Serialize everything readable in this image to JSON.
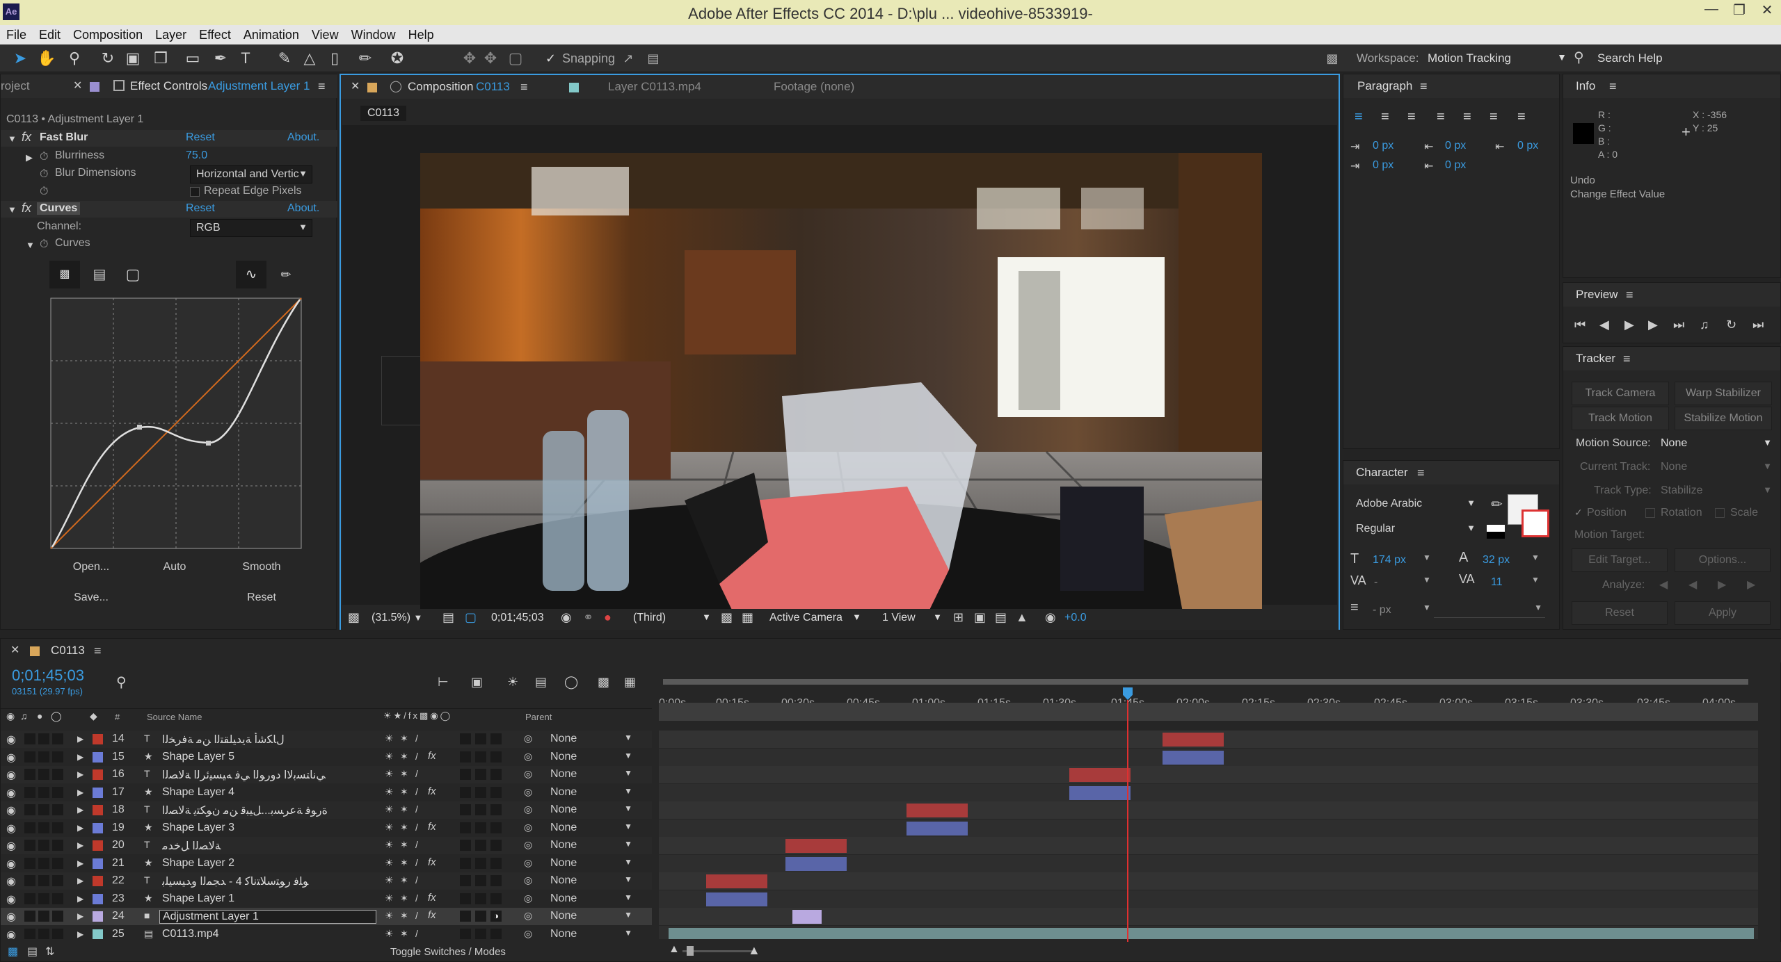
{
  "window": {
    "title": "Adobe After Effects CC 2014 - D:\\plu ... videohive-8533919-",
    "app_icon": "Ae",
    "controls": [
      "minimize-icon",
      "restore-icon",
      "close-icon"
    ]
  },
  "menu": [
    "File",
    "Edit",
    "Composition",
    "Layer",
    "Effect",
    "Animation",
    "View",
    "Window",
    "Help"
  ],
  "toolbar": {
    "snapping_label": "Snapping",
    "workspace_label": "Workspace:",
    "workspace_value": "Motion Tracking",
    "search_help": "Search Help"
  },
  "effect_controls": {
    "tab_project": "roject",
    "tab_label": "Effect Controls",
    "tab_layer": "Adjustment Layer 1",
    "breadcrumb": "C0113 • Adjustment Layer 1",
    "fast_blur": {
      "name": "Fast Blur",
      "reset": "Reset",
      "about": "About.",
      "blurriness_label": "Blurriness",
      "blurriness_value": "75.0",
      "blur_dimensions_label": "Blur Dimensions",
      "blur_dimensions_value": "Horizontal and Vertic",
      "repeat_edge": "Repeat Edge Pixels"
    },
    "curves": {
      "name": "Curves",
      "reset": "Reset",
      "about": "About.",
      "channel_label": "Channel:",
      "channel_value": "RGB",
      "curves_label": "Curves",
      "open": "Open...",
      "auto": "Auto",
      "smooth": "Smooth",
      "save": "Save...",
      "reset_btn": "Reset"
    }
  },
  "composition": {
    "tab_label": "Composition",
    "tab_name": "C0113",
    "layer_tab": "Layer  C0113.mp4",
    "footage_tab": "Footage  (none)",
    "comp_button": "C0113",
    "zoom": "(31.5%)",
    "timecode": "0;01;45;03",
    "resolution": "(Third)",
    "camera": "Active Camera",
    "views": "1 View",
    "exposure": "+0.0"
  },
  "paragraph": {
    "tab": "Paragraph",
    "indent_left": "0 px",
    "indent_first": "0 px",
    "space_before": "0 px",
    "indent_right": "0 px",
    "space_after": "0 px"
  },
  "info": {
    "tab": "Info",
    "r": "R :",
    "g": "G :",
    "b": "B :",
    "a": "A : 0",
    "x": "X : -356",
    "y": "Y : 25",
    "undo": "Undo",
    "undo_action": "Change Effect Value"
  },
  "preview": {
    "tab": "Preview"
  },
  "tracker": {
    "tab": "Tracker",
    "track_camera": "Track Camera",
    "warp_stabilizer": "Warp Stabilizer",
    "track_motion": "Track Motion",
    "stabilize_motion": "Stabilize Motion",
    "motion_source_label": "Motion Source:",
    "motion_source_value": "None",
    "current_track_label": "Current Track:",
    "current_track_value": "None",
    "track_type_label": "Track Type:",
    "track_type_value": "Stabilize",
    "position": "Position",
    "rotation": "Rotation",
    "scale": "Scale",
    "motion_target": "Motion Target:",
    "edit_target": "Edit Target...",
    "options": "Options...",
    "analyze": "Analyze:",
    "reset": "Reset",
    "apply": "Apply"
  },
  "character": {
    "tab": "Character",
    "font": "Adobe Arabic",
    "style": "Regular",
    "font_size": "174 px",
    "leading": "32 px",
    "kerning": "-",
    "tracking": "11",
    "stroke": "- px"
  },
  "timeline": {
    "tab": "C0113",
    "timecode": "0;01;45;03",
    "frames": "03151 (29.97 fps)",
    "col_number": "#",
    "col_source": "Source Name",
    "col_parent": "Parent",
    "ruler": [
      "0:00s",
      "00:15s",
      "00:30s",
      "00:45s",
      "01:00s",
      "01:15s",
      "01:30s",
      "01:45s",
      "02:00s",
      "02:15s",
      "02:30s",
      "02:45s",
      "03:00s",
      "03:15s",
      "03:30s",
      "03:45s",
      "04:00s"
    ],
    "toggle_label": "Toggle Switches / Modes",
    "layers": [
      {
        "num": "14",
        "type": "T",
        "name": "ﻝﺎﻜﺷﺃ ﺔﻳﺪﻴﻠﻘﺘﻟﺍ ﻦﻣ ﺔﻓﺮﺨﻟﺍ",
        "color": "#c0392b",
        "fx": false,
        "parent": "None"
      },
      {
        "num": "15",
        "type": "star",
        "name": "Shape Layer 5",
        "color": "#6b7bd6",
        "fx": true,
        "parent": "None"
      },
      {
        "num": "16",
        "type": "T",
        "name": "ﻲﻧﺎﺘﺴﺑﻻﺍ ﺩﻭﺭﻮﻟﺍ ﻲﻓ ﻪﻴﺴﻴﺋﺮﻟﺍ ﺔﻟﺎﺼﻟﺍ",
        "color": "#c0392b",
        "fx": false,
        "parent": "None"
      },
      {
        "num": "17",
        "type": "star",
        "name": "Shape Layer 4",
        "color": "#6b7bd6",
        "fx": true,
        "parent": "None"
      },
      {
        "num": "18",
        "type": "T",
        "name": "ﺓﺭﻮﻓ ﺔﻋﺮﺴﺑ...ﻞﻴﺒﻗ ﻦﻣ ﻥﻮﻜﺘﻳ ﺔﻟﺎﺼﻟﺍ",
        "color": "#c0392b",
        "fx": false,
        "parent": "None"
      },
      {
        "num": "19",
        "type": "star",
        "name": "Shape Layer 3",
        "color": "#6b7bd6",
        "fx": true,
        "parent": "None"
      },
      {
        "num": "20",
        "type": "T",
        "name": "ﺔﻟﺎﺼﻟﺍ ﻞﺧﺪﻣ",
        "color": "#c0392b",
        "fx": false,
        "parent": "None"
      },
      {
        "num": "21",
        "type": "star",
        "name": "Shape Layer 2",
        "color": "#6b7bd6",
        "fx": true,
        "parent": "None"
      },
      {
        "num": "22",
        "type": "T",
        "name": "ﻮﻠﻓ ﺭﻮﺘﺳﻼﺘﻧﺎﻛ 4 - ﺪﺠﻤﻟﺍ ﻭﺪﻴﺴﻴﻠﺑ",
        "color": "#c0392b",
        "fx": false,
        "parent": "None"
      },
      {
        "num": "23",
        "type": "star",
        "name": "Shape Layer 1",
        "color": "#6b7bd6",
        "fx": true,
        "parent": "None"
      },
      {
        "num": "24",
        "type": "solid",
        "name": "Adjustment Layer 1",
        "color": "#b9a9e0",
        "fx": true,
        "parent": "None",
        "selected": true
      },
      {
        "num": "25",
        "type": "footage",
        "name": "C0113.mp4",
        "color": "#83c9c9",
        "fx": false,
        "parent": "None"
      }
    ]
  },
  "colors": {
    "accent_blue": "#3a9be0",
    "playhead": "#e03030",
    "title_bar": "#e9e9b7",
    "red_bar": "#a83b3b",
    "blue_bar": "#5965a8"
  }
}
